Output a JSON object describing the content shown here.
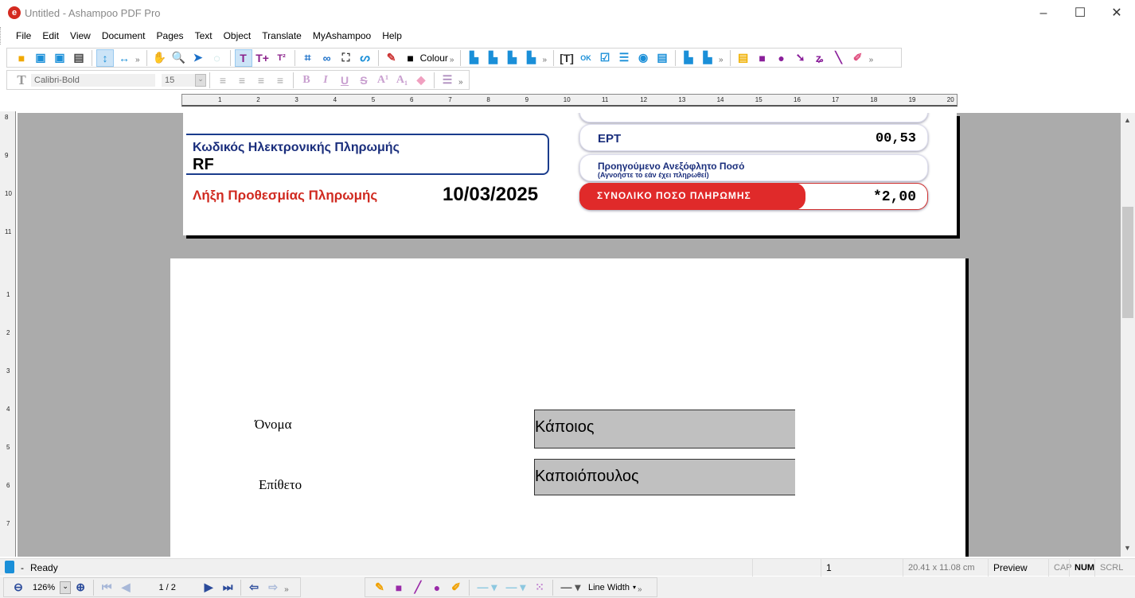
{
  "window": {
    "title": "Untitled - Ashampoo PDF Pro",
    "logo": "e",
    "minimize": "–",
    "maximize": "☐",
    "close": "✕"
  },
  "menu": [
    "File",
    "Edit",
    "View",
    "Document",
    "Pages",
    "Text",
    "Object",
    "Translate",
    "MyAshampoo",
    "Help"
  ],
  "toolbar1": {
    "colour_label": "Colour",
    "more": "»"
  },
  "toolbar2": {
    "font": "Calibri-Bold",
    "size": "15"
  },
  "ruler_h": [
    "1",
    "2",
    "3",
    "4",
    "5",
    "6",
    "7",
    "8",
    "9",
    "10",
    "11",
    "12",
    "13",
    "14",
    "15",
    "16",
    "17",
    "18",
    "19",
    "20"
  ],
  "ruler_v_top": [
    "8",
    "9",
    "10",
    "11"
  ],
  "ruler_v_bottom": [
    "1",
    "2",
    "3",
    "4",
    "5",
    "6",
    "7"
  ],
  "page1": {
    "code_label": "Κωδικός Ηλεκτρονικής Πληρωμής",
    "code_value": "RF",
    "deadline_label": "Λήξη Προθεσμίας Πληρωμής",
    "deadline_value": "10/03/2025",
    "ert_label": "ΕΡΤ",
    "ert_value": "00,53",
    "prev_label": "Προηγούμενο Ανεξόφλητο Ποσό",
    "prev_note": "(Αγνοήστε το εάν έχει πληρωθεί)",
    "total_label": "ΣΥΝΟΛΙΚΟ ΠΟΣΟ ΠΛΗΡΩΜΗΣ",
    "total_value": "*2,00",
    "accent": "#e02a2a",
    "blue": "#1a2e7c"
  },
  "page2": {
    "name_label": "Όνομα",
    "name_value": "Κάποιος",
    "surname_label": "Επίθετο",
    "surname_value": "Καποιόπουλος"
  },
  "status": {
    "lock": "-",
    "ready": "Ready",
    "page": "1",
    "size": "20.41 x 11.08 cm",
    "mode": "Preview",
    "cap": "CAP",
    "num": "NUM",
    "scrl": "SCRL"
  },
  "bottom": {
    "zoom": "126%",
    "page": "1 / 2",
    "line_width": "Line Width"
  }
}
